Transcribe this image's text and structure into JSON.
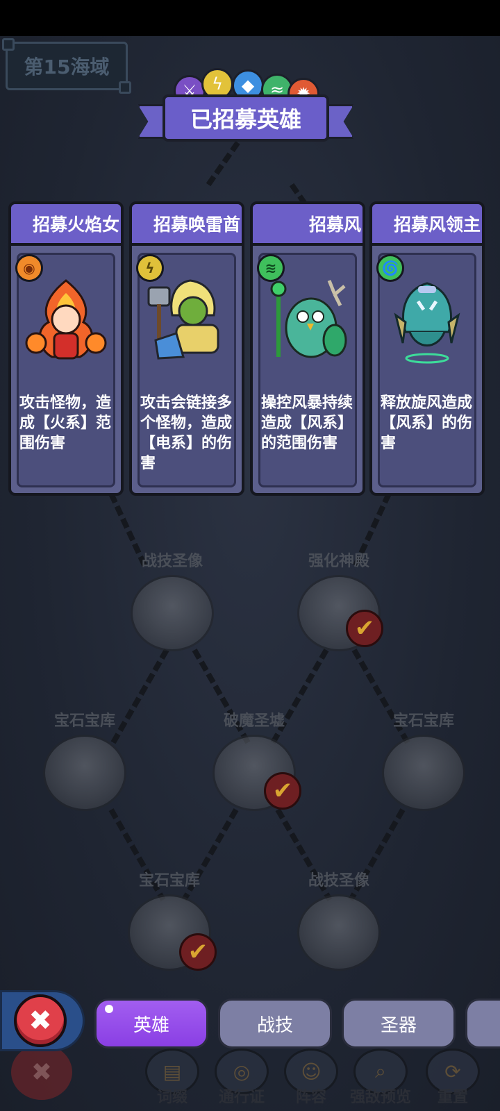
{
  "sea_label": "第15海域",
  "banner": {
    "title": "已招募英雄",
    "element_orbs": [
      {
        "icon": "sword-icon",
        "color": "#7a4fc4",
        "glyph": "⚔"
      },
      {
        "icon": "lightning-icon",
        "color": "#e2c23a",
        "glyph": "ϟ"
      },
      {
        "icon": "crystal-icon",
        "color": "#3d8fe0",
        "glyph": "◆"
      },
      {
        "icon": "wind-icon",
        "color": "#3fb36a",
        "glyph": "≈"
      },
      {
        "icon": "fire-icon",
        "color": "#e05a34",
        "glyph": "✹"
      }
    ]
  },
  "hero_cards": [
    {
      "header": "招募火焰女",
      "element_icon": "fire-element-icon",
      "element_color": "#f08a2a",
      "element_glyph": "◉",
      "description": "攻击怪物，造成【火系】范围伤害"
    },
    {
      "header": "招募唤雷酋",
      "element_icon": "thunder-element-icon",
      "element_color": "#e0c13a",
      "element_glyph": "ϟ",
      "description": "攻击会链接多个怪物，造成【电系】的伤害"
    },
    {
      "header": "招募风",
      "element_icon": "wind-element-icon",
      "element_color": "#3fbf5c",
      "element_glyph": "≋",
      "description": "操控风暴持续造成【风系】的范围伤害"
    },
    {
      "header": "招募风领主",
      "element_icon": "whirlwind-element-icon",
      "element_color": "#3fbf5c",
      "element_glyph": "🌀",
      "description": "释放旋风造成【风系】的伤害"
    }
  ],
  "map_nodes": [
    {
      "name": "战技圣像",
      "checked": false
    },
    {
      "name": "强化神殿",
      "checked": true
    },
    {
      "name": "宝石宝库",
      "checked": false
    },
    {
      "name": "破魔圣墟",
      "checked": true
    },
    {
      "name": "宝石宝库",
      "checked": false
    },
    {
      "name": "宝石宝库",
      "checked": true
    },
    {
      "name": "战技圣像",
      "checked": false
    }
  ],
  "tabs": [
    {
      "label": "英雄",
      "active": true
    },
    {
      "label": "战技",
      "active": false
    },
    {
      "label": "圣器",
      "active": false
    }
  ],
  "bottom_nav": [
    {
      "label": "词缀",
      "icon": "book-icon"
    },
    {
      "label": "通行证",
      "icon": "pass-icon"
    },
    {
      "label": "阵容",
      "icon": "team-icon"
    },
    {
      "label": "强敌预览",
      "icon": "magnifier-icon"
    },
    {
      "label": "重置",
      "icon": "refresh-icon"
    }
  ],
  "close_glyph": "✖"
}
